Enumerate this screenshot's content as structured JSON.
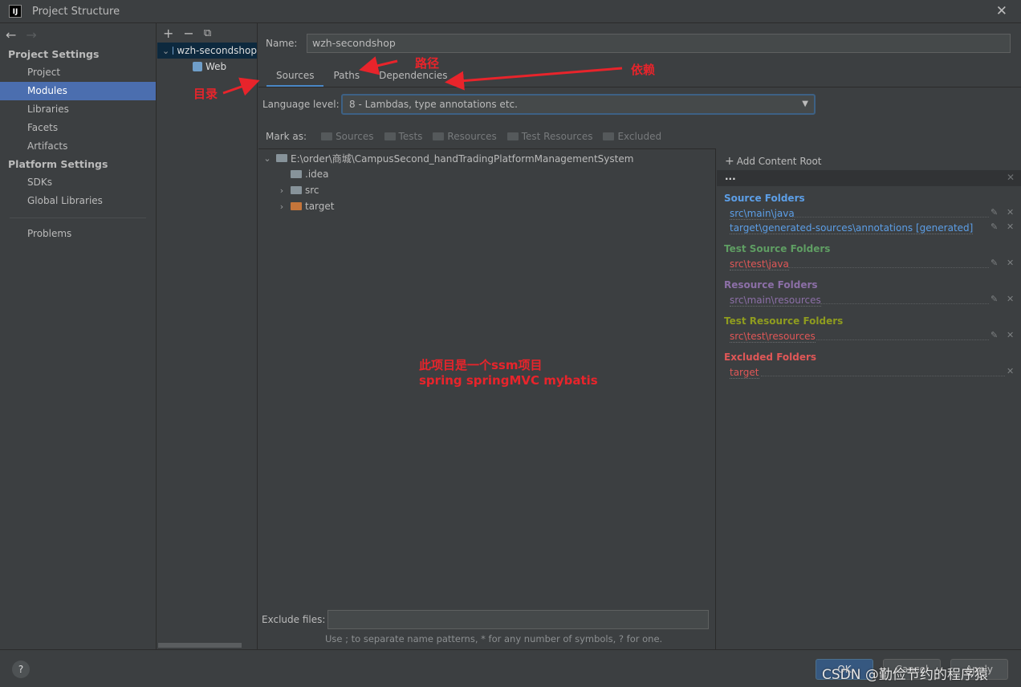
{
  "window": {
    "title": "Project Structure",
    "app_icon_text": "IJ"
  },
  "nav": {
    "back": "←",
    "forward": "→"
  },
  "sidebar": {
    "project_settings_header": "Project Settings",
    "project_items": [
      "Project",
      "Modules",
      "Libraries",
      "Facets",
      "Artifacts"
    ],
    "selected": "Modules",
    "platform_settings_header": "Platform Settings",
    "platform_items": [
      "SDKs",
      "Global Libraries"
    ],
    "problems": "Problems"
  },
  "modules": {
    "toolbar": {
      "add": "+",
      "remove": "−",
      "copy": "⧉"
    },
    "root": "wzh-secondshop",
    "child": "Web"
  },
  "main": {
    "name_label": "Name:",
    "name_value": "wzh-secondshop",
    "tabs": [
      "Sources",
      "Paths",
      "Dependencies"
    ],
    "active_tab": "Sources",
    "language_level_label": "Language level:",
    "language_level_value": "8 - Lambdas, type annotations etc.",
    "mark_as_label": "Mark as:",
    "mark_as_buttons": [
      "Sources",
      "Tests",
      "Resources",
      "Test Resources",
      "Excluded"
    ],
    "tree": {
      "root": "E:\\order\\商城\\CampusSecond_handTradingPlatformManagementSystem",
      "children": [
        ".idea",
        "src",
        "target"
      ]
    },
    "exclude_label": "Exclude files:",
    "exclude_value": "",
    "exclude_hint": "Use ; to separate name patterns, * for any number of symbols, ? for one."
  },
  "annotations": {
    "paths_cn": "路径",
    "dependencies_cn": "依赖",
    "sources_cn": "目录",
    "note_line1": "此项目是一个ssm项目",
    "note_line2": "spring springMVC mybatis"
  },
  "roots": {
    "add_content_root": "Add Content Root",
    "root_bar": "...",
    "source_folders_header": "Source Folders",
    "source_folders": [
      "src\\main\\java",
      "target\\generated-sources\\annotations [generated]"
    ],
    "test_source_header": "Test Source Folders",
    "test_source_folders": [
      "src\\test\\java"
    ],
    "resource_header": "Resource Folders",
    "resource_folders": [
      "src\\main\\resources"
    ],
    "test_resource_header": "Test Resource Folders",
    "test_resource_folders": [
      "src\\test\\resources"
    ],
    "excluded_header": "Excluded Folders",
    "excluded_folders": [
      "target"
    ]
  },
  "colors": {
    "source": "#5c9ee6",
    "test_source": "#5f9e63",
    "resource": "#8c6fa7",
    "test_resource": "#8f9c1f",
    "excluded": "#e05757",
    "selection": "#4b6eaf",
    "annotation": "#e8242b"
  },
  "bottom": {
    "help": "?",
    "ok": "OK",
    "cancel": "Cancel",
    "apply": "Apply"
  },
  "watermark": "CSDN @勤俭节约的程序猿"
}
